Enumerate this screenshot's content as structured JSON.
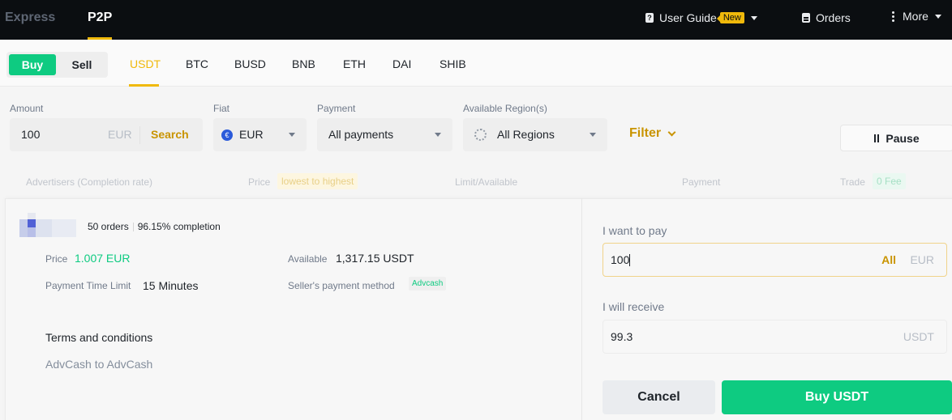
{
  "topbar": {
    "nav": [
      {
        "label": "Express",
        "active": false
      },
      {
        "label": "P2P",
        "active": true
      }
    ],
    "user_guide": {
      "label": "User Guide",
      "badge": "New",
      "icon": "user-guide-icon"
    },
    "orders": {
      "label": "Orders",
      "icon": "document-icon"
    },
    "more": {
      "label": "More",
      "icon": "vertical-dots-icon"
    }
  },
  "trade_side": {
    "buy_label": "Buy",
    "sell_label": "Sell",
    "selected": "Buy"
  },
  "assets": {
    "tabs": [
      "USDT",
      "BTC",
      "BUSD",
      "BNB",
      "ETH",
      "DAI",
      "SHIB"
    ],
    "selected": "USDT"
  },
  "filters": {
    "amount": {
      "label": "Amount",
      "value": "100",
      "currency": "EUR",
      "search_label": "Search"
    },
    "fiat": {
      "label": "Fiat",
      "value": "EUR",
      "icon": "euro-coin-icon"
    },
    "payment": {
      "label": "Payment",
      "value": "All payments"
    },
    "region": {
      "label": "Available Region(s)",
      "value": "All Regions",
      "icon": "globe-icon"
    },
    "filter_label": "Filter",
    "pause_label": "Pause"
  },
  "table_header": {
    "advertisers": "Advertisers (Completion rate)",
    "price": "Price",
    "price_sort": "lowest to highest",
    "limit": "Limit/Available",
    "payment": "Payment",
    "trade": "Trade",
    "trade_fee": "0 Fee"
  },
  "offer": {
    "orders": "50 orders",
    "completion": "96.15% completion",
    "price_label": "Price",
    "price_value": "1.007 EUR",
    "time_limit_label": "Payment Time Limit",
    "time_limit_value": "15 Minutes",
    "available_label": "Available",
    "available_value": "1,317.15 USDT",
    "method_label": "Seller's payment method",
    "method_value": "Advcash",
    "terms_title": "Terms and conditions",
    "terms_text": "AdvCash to AdvCash"
  },
  "order_form": {
    "pay_label": "I want to pay",
    "pay_value": "100",
    "pay_all": "All",
    "pay_currency": "EUR",
    "receive_label": "I will receive",
    "receive_value": "99.3",
    "receive_currency": "USDT",
    "cancel_label": "Cancel",
    "buy_label": "Buy USDT"
  },
  "colors": {
    "accent": "#f0b90b",
    "buy_green": "#0ecb81",
    "topbar_bg": "#0b0e11"
  }
}
